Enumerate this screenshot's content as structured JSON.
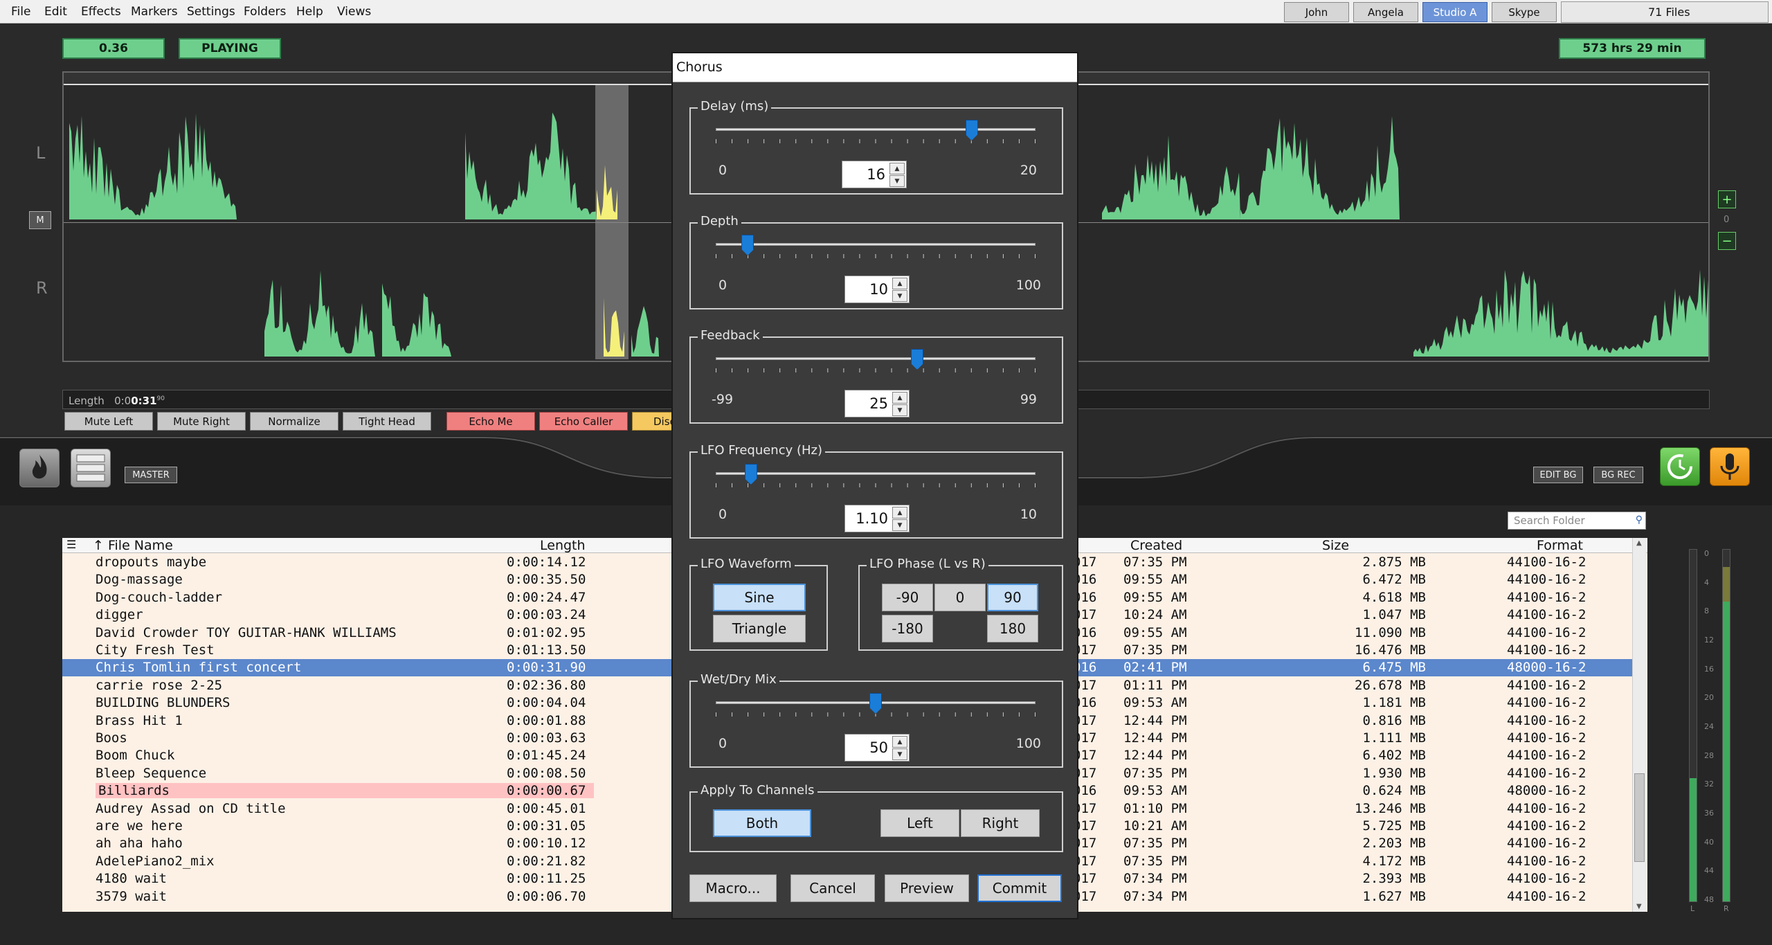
{
  "menubar": {
    "menus": [
      "File",
      "Edit",
      "Effects",
      "Markers",
      "Settings",
      "Folders",
      "Help",
      "Views"
    ],
    "users": [
      {
        "label": "John",
        "active": false
      },
      {
        "label": "Angela",
        "active": false
      },
      {
        "label": "Studio A",
        "active": true
      },
      {
        "label": "Skype",
        "active": false
      }
    ],
    "file_count": "71 Files"
  },
  "transport": {
    "position": "0.36",
    "state": "PLAYING",
    "total_time": "573 hrs  29 min"
  },
  "channels": {
    "left": "L",
    "right": "R",
    "mute_label": "M",
    "zoom_in": "+",
    "zoom_out": "−",
    "zoom_value": "0"
  },
  "length": {
    "label": "Length",
    "value_prefix": "0:0",
    "value_main": "0:31",
    "value_sup": "90"
  },
  "effect_buttons": [
    "Mute Left",
    "Mute Right",
    "Normalize",
    "Tight Head",
    "Echo Me",
    "Echo Caller",
    "Disc"
  ],
  "mid": {
    "master_label": "MASTER",
    "edit_bg": "EDIT BG",
    "bg_rec": "BG REC"
  },
  "search": {
    "placeholder": "Search Folder"
  },
  "table": {
    "headers": {
      "name": "↑ File Name",
      "length": "Length",
      "created": "Created",
      "size": "Size",
      "format": "Format"
    },
    "rows": [
      {
        "name": "dropouts maybe",
        "length": "0:00:14.12",
        "date": "017",
        "time": "07:35 PM",
        "size": "2.875 MB",
        "format": "44100-16-2"
      },
      {
        "name": "Dog-massage",
        "length": "0:00:35.50",
        "date": "016",
        "time": "09:55 AM",
        "size": "6.472 MB",
        "format": "44100-16-2"
      },
      {
        "name": "Dog-couch-ladder",
        "length": "0:00:24.47",
        "date": "016",
        "time": "09:55 AM",
        "size": "4.618 MB",
        "format": "44100-16-2"
      },
      {
        "name": "digger",
        "length": "0:00:03.24",
        "date": "017",
        "time": "10:24 AM",
        "size": "1.047 MB",
        "format": "44100-16-2"
      },
      {
        "name": "David Crowder TOY GUITAR-HANK WILLIAMS",
        "length": "0:01:02.95",
        "date": "016",
        "time": "09:55 AM",
        "size": "11.090 MB",
        "format": "44100-16-2"
      },
      {
        "name": "City Fresh Test",
        "length": "0:01:13.50",
        "date": "017",
        "time": "07:35 PM",
        "size": "16.476 MB",
        "format": "44100-16-2"
      },
      {
        "name": "Chris Tomlin first concert",
        "length": "0:00:31.90",
        "date": "016",
        "time": "02:41 PM",
        "size": "6.475 MB",
        "format": "48000-16-2"
      },
      {
        "name": "carrie rose 2-25",
        "length": "0:02:36.80",
        "date": "017",
        "time": "01:11 PM",
        "size": "26.678 MB",
        "format": "44100-16-2"
      },
      {
        "name": "BUILDING BLUNDERS",
        "length": "0:00:04.04",
        "date": "016",
        "time": "09:53 AM",
        "size": "1.181 MB",
        "format": "44100-16-2"
      },
      {
        "name": "Brass Hit 1",
        "length": "0:00:01.88",
        "date": "017",
        "time": "12:44 PM",
        "size": "0.816 MB",
        "format": "44100-16-2"
      },
      {
        "name": "Boos",
        "length": "0:00:03.63",
        "date": "017",
        "time": "12:44 PM",
        "size": "1.111 MB",
        "format": "44100-16-2"
      },
      {
        "name": "Boom Chuck",
        "length": "0:01:45.24",
        "date": "017",
        "time": "12:44 PM",
        "size": "6.402 MB",
        "format": "44100-16-2"
      },
      {
        "name": "Bleep Sequence",
        "length": "0:00:08.50",
        "date": "017",
        "time": "07:35 PM",
        "size": "1.930 MB",
        "format": "44100-16-2"
      },
      {
        "name": "Billiards",
        "length": "0:00:00.67",
        "date": "016",
        "time": "09:53 AM",
        "size": "0.624 MB",
        "format": "48000-16-2"
      },
      {
        "name": "Audrey Assad on CD title",
        "length": "0:00:45.01",
        "date": "017",
        "time": "01:10 PM",
        "size": "13.246 MB",
        "format": "44100-16-2"
      },
      {
        "name": "are we here",
        "length": "0:00:31.05",
        "date": "017",
        "time": "10:21 AM",
        "size": "5.725 MB",
        "format": "44100-16-2"
      },
      {
        "name": "ah aha haho",
        "length": "0:00:10.12",
        "date": "017",
        "time": "07:35 PM",
        "size": "2.203 MB",
        "format": "44100-16-2"
      },
      {
        "name": "AdelePiano2_mix",
        "length": "0:00:21.82",
        "date": "017",
        "time": "07:35 PM",
        "size": "4.172 MB",
        "format": "44100-16-2"
      },
      {
        "name": "4180 wait",
        "length": "0:00:11.25",
        "date": "017",
        "time": "07:34 PM",
        "size": "2.393 MB",
        "format": "44100-16-2"
      },
      {
        "name": "3579 wait",
        "length": "0:00:06.70",
        "date": "017",
        "time": "07:34 PM",
        "size": "1.627 MB",
        "format": "44100-16-2"
      }
    ]
  },
  "meter": {
    "scale": [
      "0",
      "4",
      "8",
      "12",
      "16",
      "20",
      "24",
      "28",
      "32",
      "36",
      "40",
      "44",
      "48"
    ],
    "left_label": "L",
    "right_label": "R",
    "left_level": 0.35,
    "right_level": 0.92
  },
  "dialog": {
    "title": "Chorus",
    "delay": {
      "label": "Delay (ms)",
      "min": "0",
      "max": "20",
      "value": "16",
      "fraction": 0.8
    },
    "depth": {
      "label": "Depth",
      "min": "0",
      "max": "100",
      "value": "10",
      "fraction": 0.1
    },
    "feedback": {
      "label": "Feedback",
      "min": "-99",
      "max": "99",
      "value": "25",
      "fraction": 0.63
    },
    "lfo_freq": {
      "label": "LFO Frequency (Hz)",
      "min": "0",
      "max": "10",
      "value": "1.10",
      "fraction": 0.11
    },
    "waveform": {
      "label": "LFO Waveform",
      "sine": "Sine",
      "triangle": "Triangle",
      "selected": "Sine"
    },
    "phase": {
      "label": "LFO Phase (L vs R)",
      "m90": "-90",
      "zero": "0",
      "p90": "90",
      "m180": "-180",
      "p180": "180",
      "selected": "90"
    },
    "mix": {
      "label": "Wet/Dry Mix",
      "min": "0",
      "max": "100",
      "value": "50",
      "fraction": 0.5
    },
    "channels": {
      "label": "Apply To Channels",
      "both": "Both",
      "left": "Left",
      "right": "Right",
      "selected": "Both"
    },
    "buttons": {
      "macro": "Macro...",
      "cancel": "Cancel",
      "preview": "Preview",
      "commit": "Commit"
    }
  },
  "colors": {
    "wave": "#6ecf8d",
    "wave_sel": "#f5f07a",
    "selected_row": "#5b87cc",
    "accent": "#1a7dd8"
  }
}
